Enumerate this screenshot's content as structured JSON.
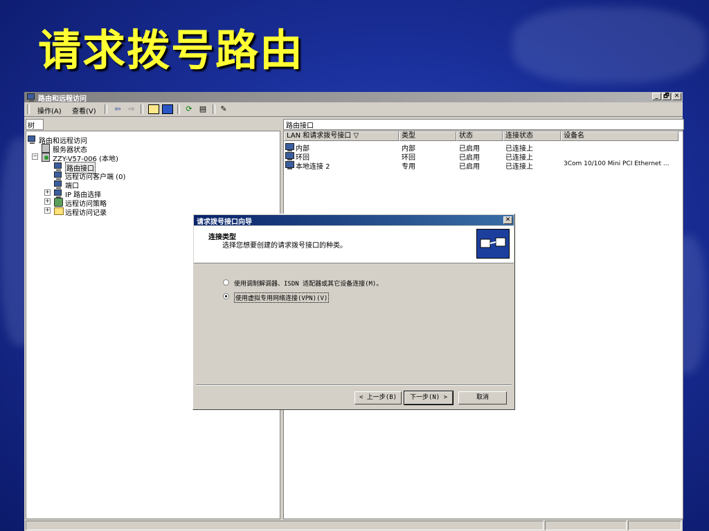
{
  "slide": {
    "title": "请求拨号路由"
  },
  "window": {
    "title": "路由和远程访问",
    "controls": [
      "_",
      "🗗",
      "✕"
    ]
  },
  "menu": {
    "items": [
      "操作(A)",
      "查看(V)"
    ]
  },
  "toolbar": {
    "icons": [
      "back-icon",
      "forward-icon",
      "up-folder-icon",
      "show-tree-icon",
      "refresh-icon",
      "export-icon",
      "help-icon"
    ]
  },
  "tree": {
    "tab_label": "树",
    "nodes": [
      {
        "label": "路由和远程访问",
        "icon": "routing-icon"
      },
      {
        "label": "服务器状态",
        "icon": "server-icon"
      },
      {
        "label": "ZZY-V57-006 (本地)",
        "icon": "server-local-icon"
      },
      {
        "label": "路由接口",
        "icon": "interface-icon"
      },
      {
        "label": "远程访问客户端 (0)",
        "icon": "client-icon"
      },
      {
        "label": "端口",
        "icon": "port-icon"
      },
      {
        "label": "IP 路由选择",
        "icon": "ip-routing-icon"
      },
      {
        "label": "远程访问策略",
        "icon": "policy-icon"
      },
      {
        "label": "远程访问记录",
        "icon": "folder-icon"
      }
    ]
  },
  "list": {
    "header": "路由接口",
    "columns": [
      "LAN 和请求拨号接口  ▽",
      "类型",
      "状态",
      "连接状态",
      "设备名"
    ],
    "rows": [
      {
        "name": "内部",
        "type": "内部",
        "status": "已启用",
        "conn": "已连接上",
        "device": ""
      },
      {
        "name": "环回",
        "type": "环回",
        "status": "已启用",
        "conn": "已连接上",
        "device": ""
      },
      {
        "name": "本地连接 2",
        "type": "专用",
        "status": "已启用",
        "conn": "已连接上",
        "device": "3Com 10/100 Mini PCI Ethernet ..."
      }
    ]
  },
  "dialog": {
    "title": "请求拨号接口向导",
    "heading": "连接类型",
    "subheading": "选择您想要创建的请求拨号接口的种类。",
    "options": [
      {
        "label": "使用调制解调器、ISDN 适配器或其它设备连接(M)。",
        "selected": false
      },
      {
        "label": "使用虚拟专用网络连接(VPN)(V)",
        "selected": true
      }
    ],
    "buttons": {
      "back": "< 上一步(B)",
      "next": "下一步(N) >",
      "cancel": "取消"
    }
  }
}
